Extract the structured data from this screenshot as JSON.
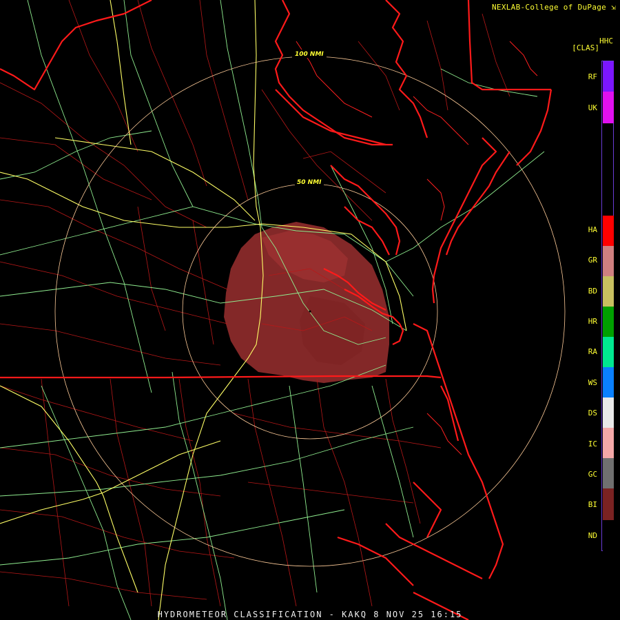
{
  "credit": "NEXLAB-College of DuPage",
  "title": "HYDROMETEOR CLASSIFICATION - KAKQ 8 NOV 25 16:15",
  "ring_labels": {
    "outer": "100 NMI",
    "inner": "50 NMI"
  },
  "legend": {
    "product": "HHC",
    "unit": "[CLAS]",
    "items": [
      {
        "code": "RF",
        "color": "#7b16ff"
      },
      {
        "code": "UK",
        "color": "#e010f0"
      },
      {
        "code": "HA",
        "color": "#ff0000"
      },
      {
        "code": "GR",
        "color": "#d08080"
      },
      {
        "code": "BD",
        "color": "#c8c060"
      },
      {
        "code": "HR",
        "color": "#00a000"
      },
      {
        "code": "RA",
        "color": "#00e890"
      },
      {
        "code": "WS",
        "color": "#0a80ff"
      },
      {
        "code": "DS",
        "color": "#e8e8e8"
      },
      {
        "code": "IC",
        "color": "#f4a8a8"
      },
      {
        "code": "GC",
        "color": "#707070"
      },
      {
        "code": "BI",
        "color": "#7a2222"
      },
      {
        "code": "ND",
        "color": "#000000"
      }
    ]
  },
  "colors": {
    "background": "#000000",
    "state_border": "#ff1a1a",
    "county_line": "#c01818",
    "interstate": "#ffff66",
    "highway": "#90ee90",
    "range_ring": "#ffcc99",
    "echo": "#8a2a2a",
    "label_text": "#ffff33"
  }
}
